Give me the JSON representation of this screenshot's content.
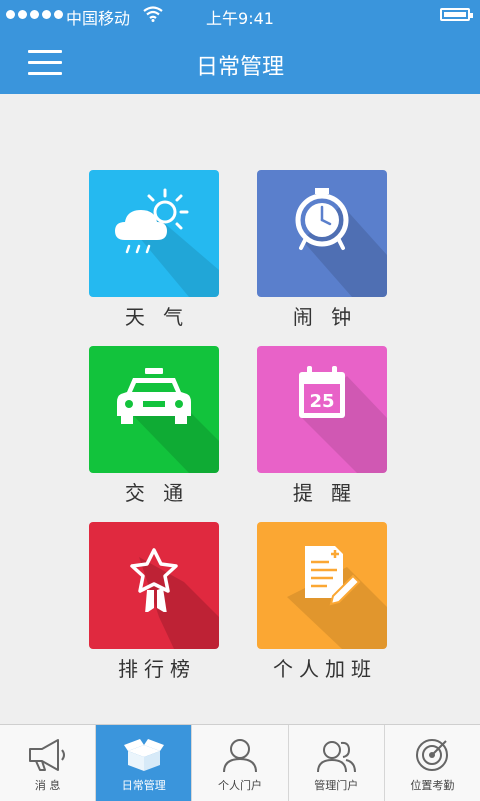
{
  "status_bar": {
    "carrier": "中国移动",
    "time": "上午9:41"
  },
  "header": {
    "title": "日常管理",
    "menu_icon": "hamburger-icon"
  },
  "tiles": [
    {
      "label": "天 气",
      "icon": "weather-icon",
      "color": "#25b9f0"
    },
    {
      "label": "闹 钟",
      "icon": "alarm-clock-icon",
      "color": "#5a7fcc"
    },
    {
      "label": "交 通",
      "icon": "taxi-icon",
      "color": "#12c33c"
    },
    {
      "label": "提 醒",
      "icon": "calendar-icon",
      "color": "#e862c8",
      "calendar_day": "25"
    },
    {
      "label": "排行榜",
      "icon": "ribbon-star-icon",
      "color": "#e0293f"
    },
    {
      "label": "个人加班",
      "icon": "document-edit-icon",
      "color": "#fba733"
    }
  ],
  "tabbar": {
    "items": [
      {
        "label": "消 息",
        "icon": "megaphone-icon",
        "active": false
      },
      {
        "label": "日常管理",
        "icon": "open-box-icon",
        "active": true
      },
      {
        "label": "个人门户",
        "icon": "person-icon",
        "active": false
      },
      {
        "label": "管理门户",
        "icon": "group-icon",
        "active": false
      },
      {
        "label": "位置考勤",
        "icon": "target-icon",
        "active": false
      }
    ]
  },
  "colors": {
    "primary": "#3a95dc",
    "background": "#efefef"
  }
}
